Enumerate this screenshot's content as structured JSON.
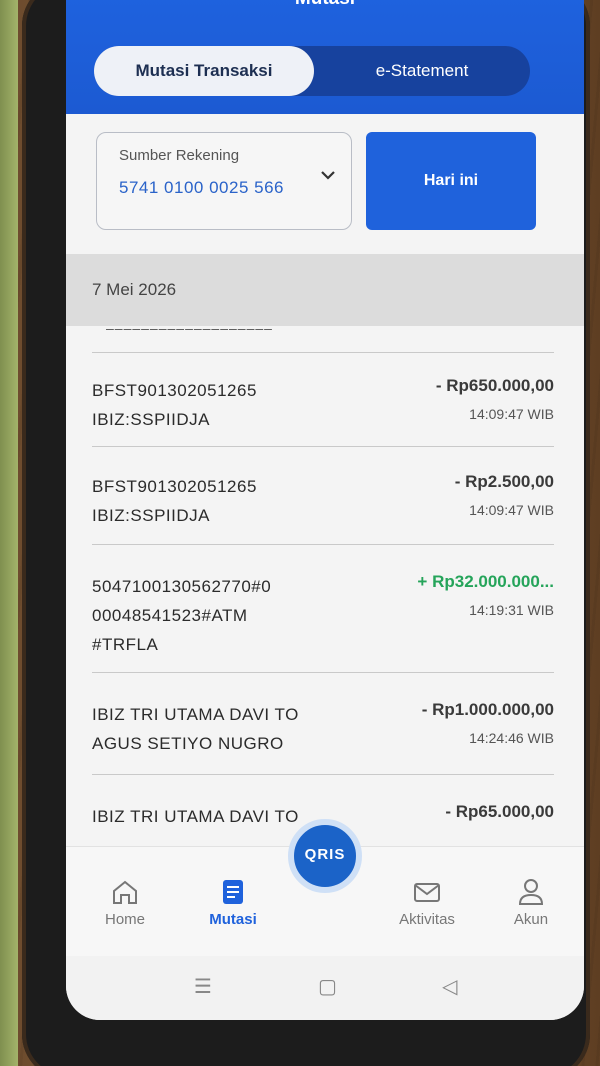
{
  "header": {
    "title": "Mutasi"
  },
  "tabs": [
    {
      "label": "Mutasi Transaksi",
      "active": true
    },
    {
      "label": "e-Statement",
      "active": false
    }
  ],
  "account": {
    "label": "Sumber Rekening",
    "number": "5741 0100 0025 566"
  },
  "filter_button": {
    "label": "Hari ini"
  },
  "date_header": "7 Mei 2026",
  "transactions": [
    {
      "desc_line1": "BFST901302051265",
      "desc_line2": "IBIZ:SSPIIDJA",
      "desc_line3": "",
      "amount": "- Rp650.000,00",
      "time": "14:09:47 WIB",
      "type": "debit"
    },
    {
      "desc_line1": "BFST901302051265",
      "desc_line2": "IBIZ:SSPIIDJA",
      "desc_line3": "",
      "amount": "- Rp2.500,00",
      "time": "14:09:47 WIB",
      "type": "debit"
    },
    {
      "desc_line1": "5047100130562770#0",
      "desc_line2": "00048541523#ATM",
      "desc_line3": "#TRFLA",
      "amount": "+ Rp32.000.000...",
      "time": "14:19:31 WIB",
      "type": "credit"
    },
    {
      "desc_line1": "IBIZ TRI UTAMA DAVI TO",
      "desc_line2": "AGUS SETIYO NUGRO",
      "desc_line3": "",
      "amount": "- Rp1.000.000,00",
      "time": "14:24:46 WIB",
      "type": "debit"
    },
    {
      "desc_line1": "IBIZ TRI UTAMA DAVI TO",
      "desc_line2": "",
      "desc_line3": "",
      "amount": "- Rp65.000,00",
      "time": "",
      "type": "debit"
    }
  ],
  "nav": {
    "home": "Home",
    "mutasi": "Mutasi",
    "qris": "QRIS",
    "aktivitas": "Aktivitas",
    "akun": "Akun"
  },
  "colors": {
    "brand_blue": "#1f62dc",
    "credit_green": "#25a45a"
  }
}
